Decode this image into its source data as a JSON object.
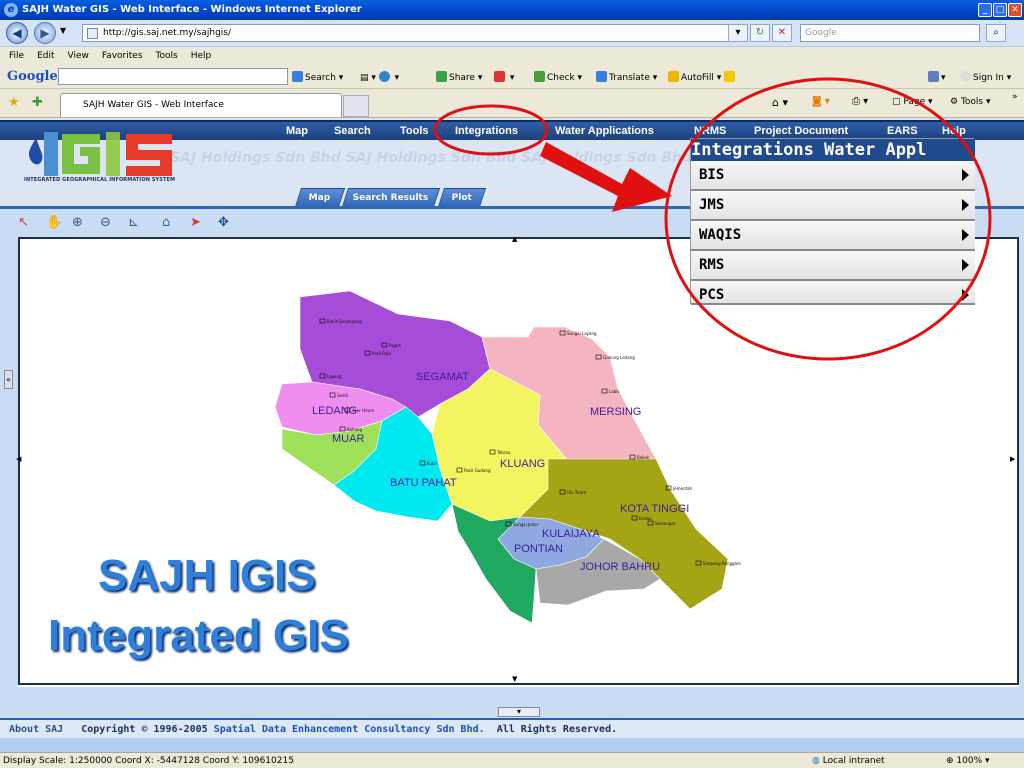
{
  "window": {
    "title": "SAJH Water GIS - Web Interface - Windows Internet Explorer"
  },
  "address": {
    "url": "http://gis.saj.net.my/sajhgis/",
    "search_placeholder": "Google"
  },
  "menu": [
    "File",
    "Edit",
    "View",
    "Favorites",
    "Tools",
    "Help"
  ],
  "google_toolbar": {
    "logo": "Google",
    "items": [
      "Search",
      "Share",
      "Check",
      "Translate",
      "AutoFill",
      "Sign In"
    ]
  },
  "tabs": {
    "active": "SAJH Water GIS - Web Interface",
    "page_tools": "Page",
    "tools": "Tools"
  },
  "site_nav": [
    "Map",
    "Search",
    "Tools",
    "Integrations",
    "Water Applications",
    "NRMS",
    "Project Document",
    "EARS",
    "Help"
  ],
  "logo": {
    "text": "IGIS",
    "subtitle": "INTEGRATED GEOGRAPHICAL INFORMATION SYSTEM",
    "watermark": "SAJ Holdings Sdn Bhd   SAJ Holdings Sdn Bhd   SAJ Holdings Sdn Bhd   SAJ Holdings Sdn Bhd"
  },
  "panel_tabs": [
    "Map",
    "Search Results",
    "Plot"
  ],
  "map_tools": [
    "select-arrow-icon",
    "pan-hand-icon",
    "zoom-in-icon",
    "zoom-out-icon",
    "measure-icon",
    "home-icon",
    "identify-icon",
    "move-icon"
  ],
  "dropdown": {
    "header": "Integrations   Water Appl",
    "items": [
      "BIS",
      "JMS",
      "WAQIS",
      "RMS",
      "PCS"
    ]
  },
  "districts": [
    "SEGAMAT",
    "LEDANG",
    "MUAR",
    "BATU PAHAT",
    "KLUANG",
    "MERSING",
    "KOTA TINGGI",
    "KULAIJAYA",
    "PONTIAN",
    "JOHOR BAHRU"
  ],
  "points": [
    "Bukit Serampang",
    "Pagoh",
    "Parit Raja",
    "Layang",
    "Sedili",
    "Ayer Hitam",
    "Kahang",
    "Kulai",
    "Tebrau",
    "Pasir Gudang",
    "Sungai Layang",
    "Gunung Ledang",
    "Labis",
    "Bekok",
    "Jementah",
    "Ulu Tiram",
    "Endau",
    "Semangar",
    "Simpang Renggam",
    "Sungai Johor"
  ],
  "overlay": {
    "line1": "SAJH IGIS",
    "line2": "Integrated GIS"
  },
  "footer": {
    "about": "About SAJ",
    "copyright": "Copyright © 1996-2005",
    "company": "Spatial Data Enhancement Consultancy Sdn Bhd.",
    "rights": "All Rights Reserved."
  },
  "status": {
    "coords": "Display Scale: 1:250000 Coord X: -5447128 Coord Y: 109610215",
    "zone": "Local intranet",
    "zoom": "100%"
  },
  "colors": {
    "nav": "#1f4a8e",
    "accent": "#2f7fd8",
    "highlight_circle": "#e01010"
  }
}
